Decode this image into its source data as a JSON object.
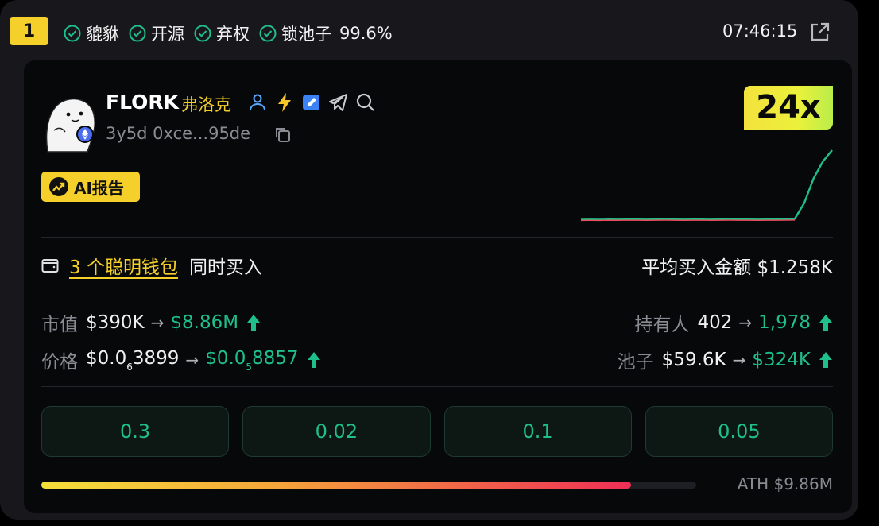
{
  "header": {
    "rank": "1",
    "tags": [
      "貔貅",
      "开源",
      "弃权",
      "锁池子"
    ],
    "lock_pct": "99.6%",
    "time": "07:46:15"
  },
  "token": {
    "symbol": "FLORK",
    "cn_name": "弗洛克",
    "age": "3y5d",
    "address": "0xce...95de",
    "multiplier": "24x",
    "chain_icon": "ethereum-icon"
  },
  "ai_report": {
    "label": "AI报告"
  },
  "smart_money": {
    "link": "3 个聪明钱包",
    "suffix": "同时买入",
    "avg_label": "平均买入金额",
    "avg_value": "$1.258K"
  },
  "stats": {
    "mcap": {
      "label": "市值",
      "from": "$390K",
      "to": "$8.86M"
    },
    "price": {
      "label": "价格",
      "from_prefix": "$0.0",
      "from_zeros": "6",
      "from_digits": "3899",
      "to_prefix": "$0.0",
      "to_zeros": "5",
      "to_digits": "8857"
    },
    "holders": {
      "label": "持有人",
      "from": "402",
      "to": "1,978"
    },
    "pool": {
      "label": "池子",
      "from": "$59.6K",
      "to": "$324K"
    },
    "arrow": "→"
  },
  "buy_buttons": [
    "0.3",
    "0.02",
    "0.1",
    "0.05"
  ],
  "progress": {
    "fraction": 0.9,
    "ath_label": "ATH $9.86M"
  },
  "colors": {
    "accent_yellow": "#f5d02a",
    "up_green": "#1fbf8a",
    "down_red": "#ef4b5a"
  },
  "chart_data": {
    "type": "line",
    "series_values": [
      0.2,
      0.21,
      0.2,
      0.22,
      0.21,
      0.23,
      0.22,
      0.21,
      0.22,
      0.23,
      0.22,
      0.21,
      0.22,
      0.22,
      0.21,
      0.22,
      0.23,
      0.22,
      0.22,
      0.21,
      0.22,
      0.22,
      0.23,
      0.24,
      2.0,
      4.6,
      6.4,
      7.6
    ],
    "line_color_up": "#1fbf8a",
    "line_color_down": "#ef4b5a"
  }
}
